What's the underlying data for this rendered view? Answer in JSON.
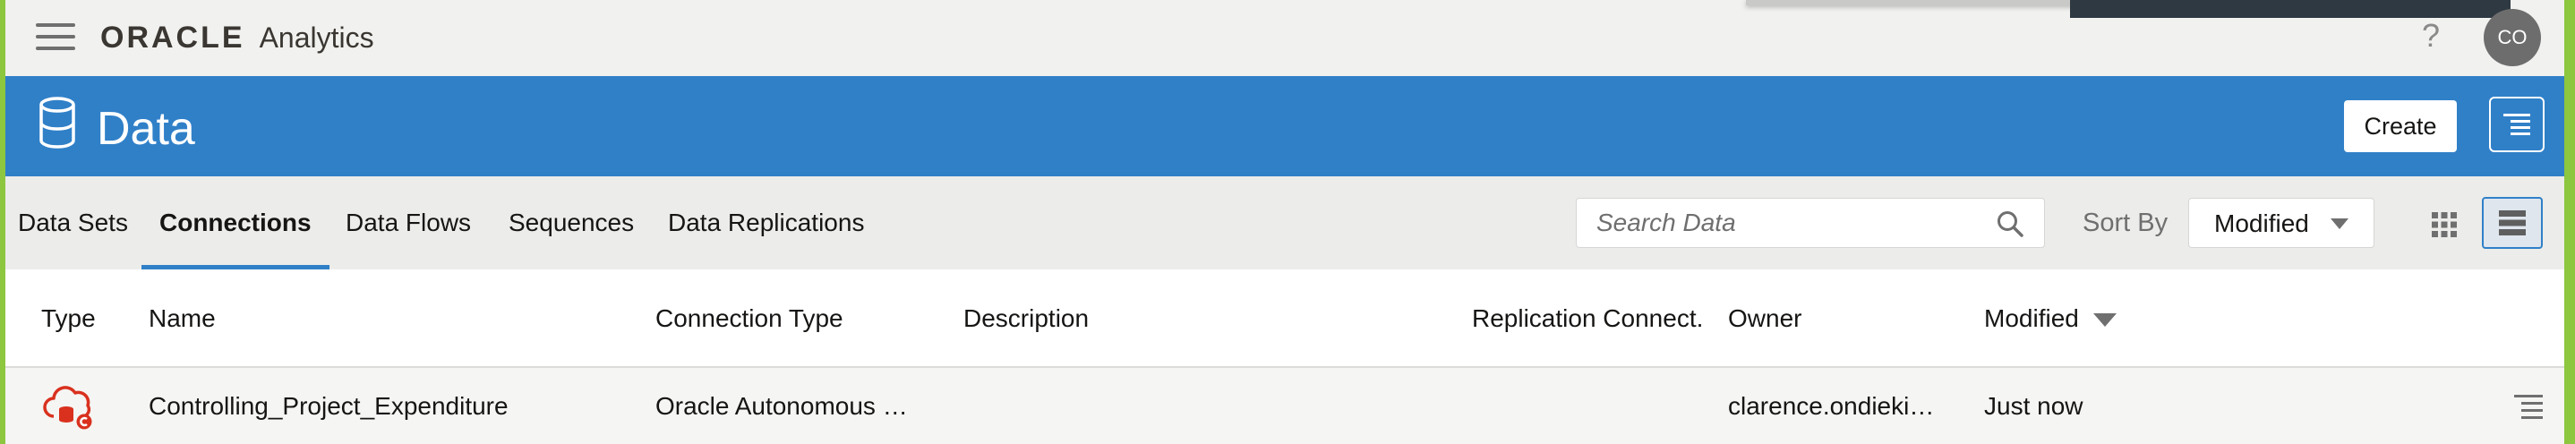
{
  "app": {
    "brand_oracle": "ORACLE",
    "brand_product": "Analytics",
    "help": "?",
    "avatar_initials": "CO"
  },
  "header": {
    "title": "Data",
    "create_label": "Create"
  },
  "tabs": [
    {
      "label": "Data Sets",
      "active": false
    },
    {
      "label": "Connections",
      "active": true
    },
    {
      "label": "Data Flows",
      "active": false
    },
    {
      "label": "Sequences",
      "active": false
    },
    {
      "label": "Data Replications",
      "active": false
    }
  ],
  "search": {
    "placeholder": "Search Data",
    "value": ""
  },
  "sort": {
    "label": "Sort By",
    "value": "Modified"
  },
  "table": {
    "columns": {
      "type": "Type",
      "name": "Name",
      "connection_type": "Connection Type",
      "description": "Description",
      "replication": "Replication Connect.",
      "owner": "Owner",
      "modified": "Modified"
    },
    "rows": [
      {
        "type_icon": "cloud-database-icon",
        "name": "Controlling_Project_Expenditure",
        "connection_type": "Oracle Autonomous …",
        "description": "",
        "replication": "",
        "owner": "clarence.ondieki…",
        "modified": "Just now"
      }
    ]
  },
  "colors": {
    "accent_blue": "#3080c8",
    "frame_green": "#8dc63f",
    "icon_red": "#d9311e"
  }
}
